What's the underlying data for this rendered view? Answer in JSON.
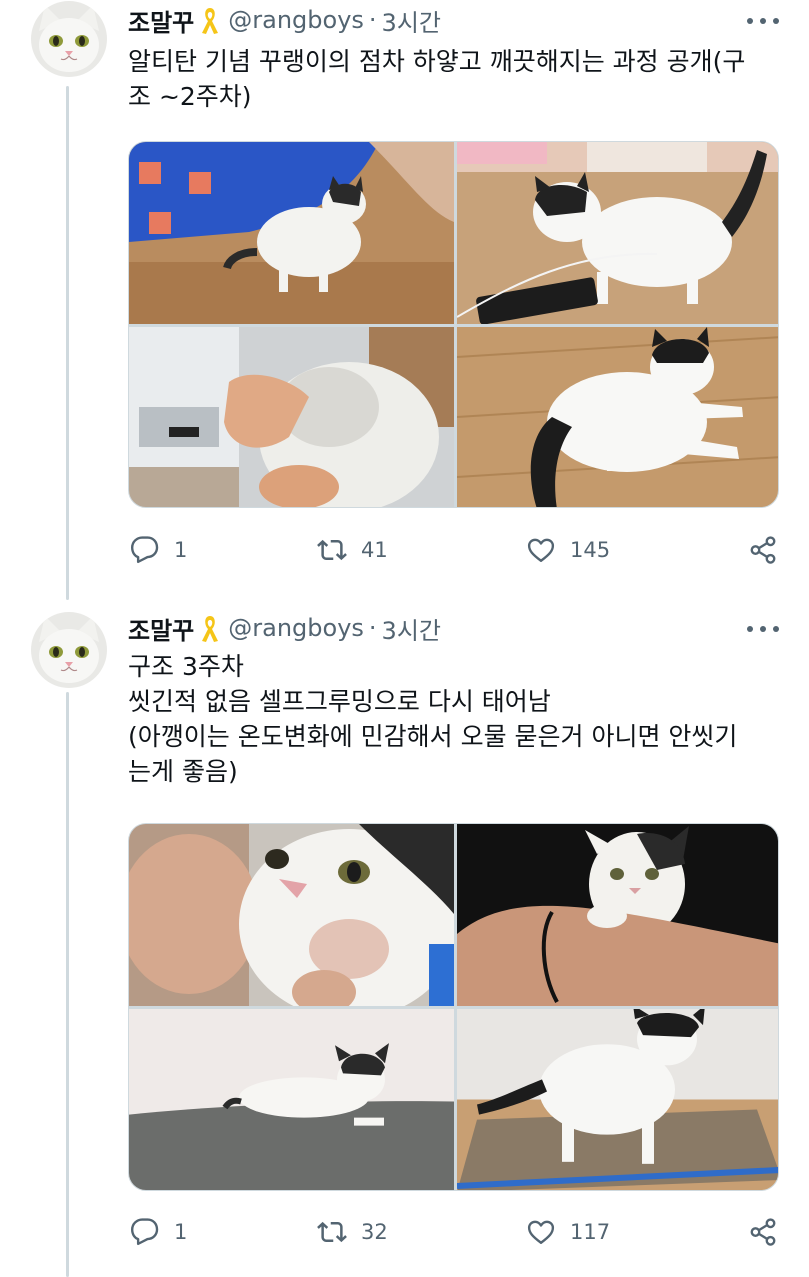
{
  "tweets": [
    {
      "author": {
        "name": "조말꾸",
        "handle": "@rangboys",
        "separator": "·",
        "time": "3시간"
      },
      "text_lines": [
        "알티탄 기념 꾸랭이의 점차 하얗고 깨끗해지는 과정 공개(구",
        "조 ~2주차)"
      ],
      "photos": [
        "kitten-on-floor-blue-pajamas",
        "kitten-walking-by-phone",
        "kitten-belly-held-in-hand",
        "kitten-crouching-on-floor"
      ],
      "stats": {
        "replies": "1",
        "retweets": "41",
        "likes": "145"
      }
    },
    {
      "author": {
        "name": "조말꾸",
        "handle": "@rangboys",
        "separator": "·",
        "time": "3시간"
      },
      "text_lines": [
        "구조 3주차",
        "씻긴적 없음 셀프그루밍으로 다시 태어남",
        "(아깽이는 온도변화에 민감해서 오물 묻은거 아니면 안씻기",
        "는게 좋음)"
      ],
      "photos": [
        "kitten-face-closeup-held",
        "kitten-on-arm",
        "kitten-lying-on-cushion",
        "kitten-standing-on-scratcher"
      ],
      "stats": {
        "replies": "1",
        "retweets": "32",
        "likes": "117"
      }
    }
  ],
  "icons": {
    "avatar": "white-cat-face-icon",
    "badge": "yellow-ribbon-icon",
    "more": "more-options-icon",
    "reply": "reply-icon",
    "retweet": "retweet-icon",
    "like": "heart-icon",
    "share": "share-icon"
  },
  "colors": {
    "text": "#0f1419",
    "secondary": "#536471",
    "border": "#cfd9de",
    "ribbon": "#f5c518"
  }
}
